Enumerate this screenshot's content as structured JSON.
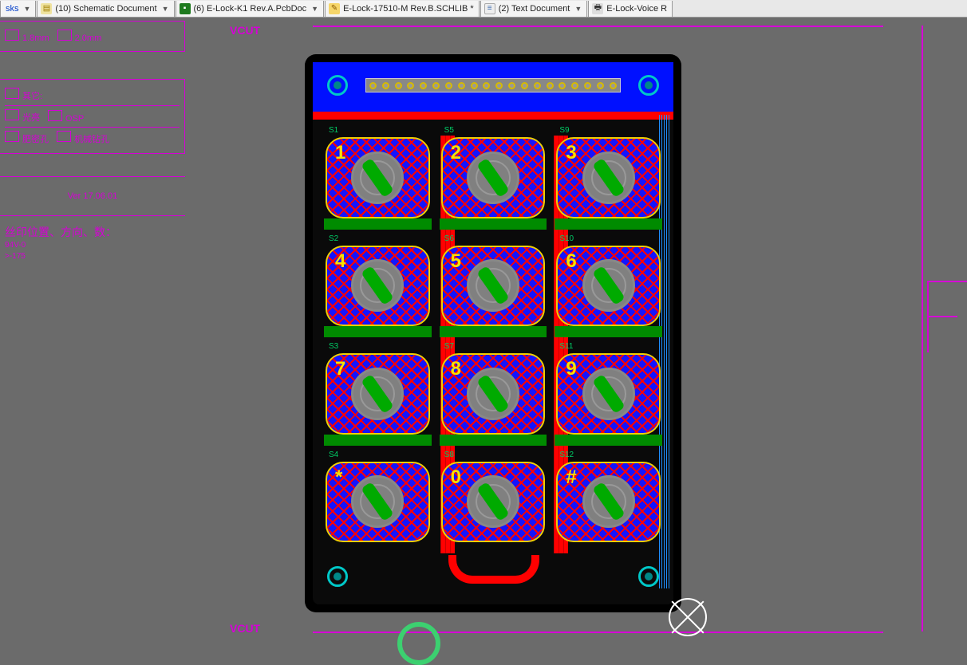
{
  "tabs": [
    {
      "label": "sks",
      "dropdown": true,
      "icon": "cut"
    },
    {
      "label": "(10) Schematic Document",
      "dropdown": true,
      "icon": "sch"
    },
    {
      "label": "(6) E-Lock-K1 Rev.A.PcbDoc",
      "dropdown": true,
      "icon": "pcb"
    },
    {
      "label": "E-Lock-17510-M Rev.B.SCHLIB *",
      "dropdown": false,
      "icon": "lib"
    },
    {
      "label": "(2) Text Document",
      "dropdown": true,
      "icon": "txt"
    },
    {
      "label": "E-Lock-Voice R",
      "dropdown": false,
      "icon": "report"
    }
  ],
  "fabnotes": {
    "row1": {
      "opt_a": "1.8mm",
      "opt_b": "2.0mm"
    },
    "row2": {
      "opt_a": "其它:"
    },
    "row3": {
      "opt_a": "光亮",
      "opt_b": "OSP"
    },
    "row4": {
      "opt_a": "肥密孔",
      "opt_b": "机械钻孔"
    },
    "version": "Ver 17.06.01",
    "notes_title": "丝印位置、方向、数：",
    "notes_line1": "94V-0",
    "notes_line2": ">-175"
  },
  "vcut_top": "VCUT",
  "vcut_bottom": "VCUT",
  "pcb": {
    "keys": [
      {
        "designator": "S1",
        "num": "1"
      },
      {
        "designator": "S5",
        "num": "2"
      },
      {
        "designator": "S9",
        "num": "3"
      },
      {
        "designator": "S2",
        "num": "4"
      },
      {
        "designator": "S6",
        "num": "5"
      },
      {
        "designator": "S10",
        "num": "6"
      },
      {
        "designator": "S3",
        "num": "7"
      },
      {
        "designator": "S7",
        "num": "8"
      },
      {
        "designator": "S11",
        "num": "9"
      },
      {
        "designator": "S4",
        "num": "*"
      },
      {
        "designator": "S8",
        "num": "0"
      },
      {
        "designator": "S12",
        "num": "#"
      }
    ],
    "connector_pins": 20
  }
}
